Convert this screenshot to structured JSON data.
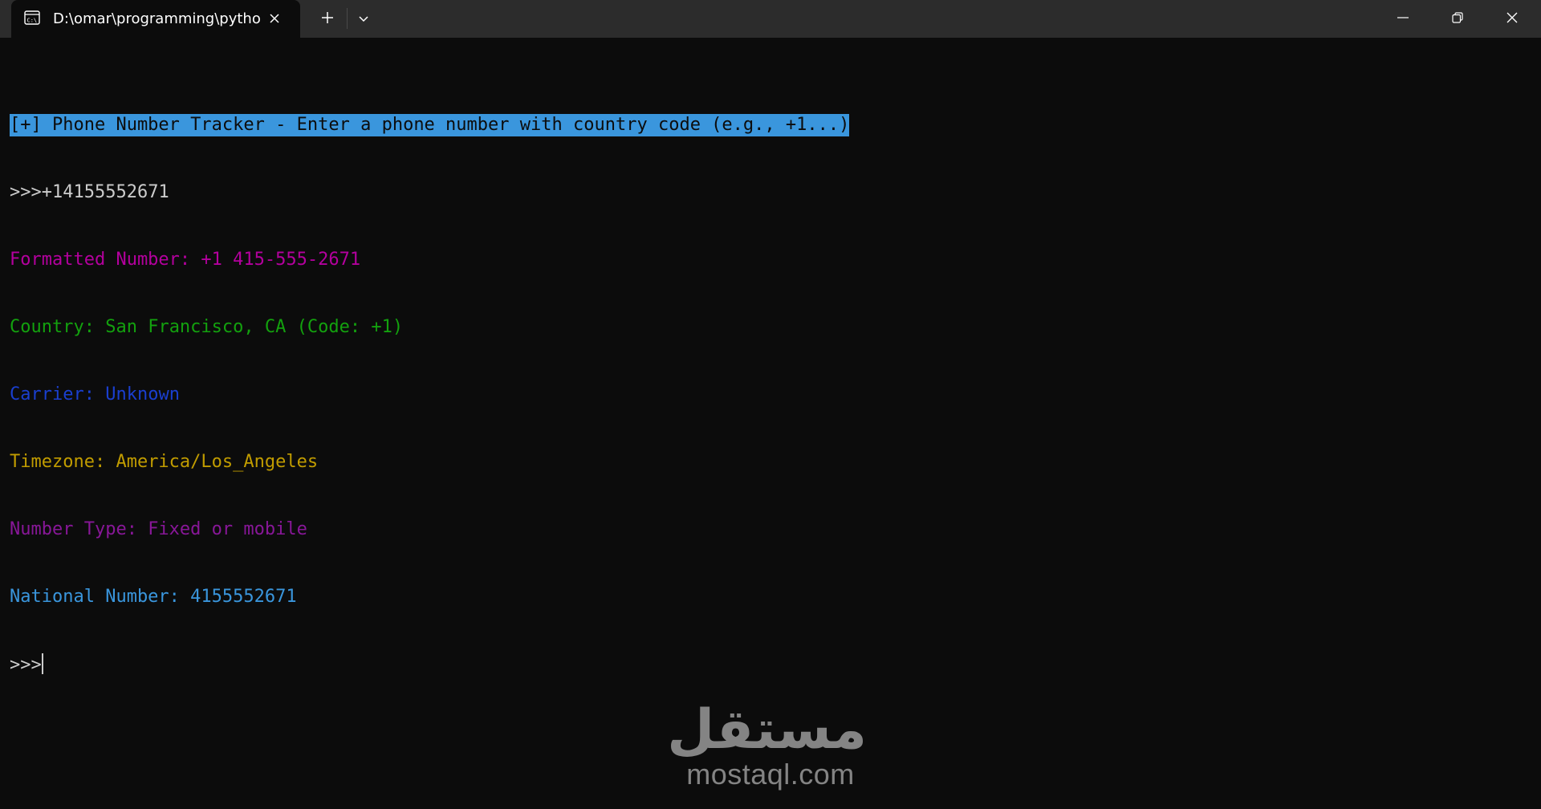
{
  "window": {
    "tab_title": "D:\\omar\\programming\\pytho",
    "icons": {
      "tab": "terminal-cmd-icon",
      "tab_close": "close-icon",
      "new_tab": "plus-icon",
      "dropdown": "chevron-down-icon",
      "minimize": "minimize-icon",
      "restore": "restore-icon",
      "close": "close-icon"
    }
  },
  "terminal": {
    "header_line": "[+] Phone Number Tracker - Enter a phone number with country code (e.g., +1...)",
    "prompt": ">>>",
    "input_value": "+14155552671",
    "results": [
      {
        "label": "Formatted Number: ",
        "value": "+1 415-555-2671",
        "color": "#b4009e"
      },
      {
        "label": "Country: ",
        "value": "San Francisco, CA (Code: +1)",
        "color": "#13a10e"
      },
      {
        "label": "Carrier: ",
        "value": "Unknown",
        "color": "#1a3fcf"
      },
      {
        "label": "Timezone: ",
        "value": "America/Los_Angeles",
        "color": "#c19c00"
      },
      {
        "label": "Number Type: ",
        "value": "Fixed or mobile",
        "color": "#881798"
      },
      {
        "label": "National Number: ",
        "value": "4155552671",
        "color": "#3a96dd"
      }
    ],
    "colors": {
      "background": "#0c0c0c",
      "foreground": "#cccccc",
      "selection": "#3a96dd"
    }
  },
  "watermark": {
    "logo_text": "مستقل",
    "url": "mostaql.com"
  }
}
